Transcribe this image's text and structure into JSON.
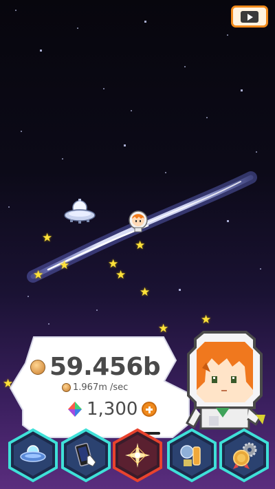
{
  "stats": {
    "coin_total": "59.456b",
    "coin_rate": "1.967m /sec",
    "gem_count": "1,300"
  },
  "icons": {
    "video": "video-ad-icon",
    "coin": "coin-icon",
    "gem": "rainbow-gem-icon",
    "add": "plus-icon"
  },
  "nav": [
    {
      "name": "ufo",
      "icon": "ufo-icon",
      "selected": false
    },
    {
      "name": "phone",
      "icon": "phone-tap-icon",
      "selected": false
    },
    {
      "name": "galaxy",
      "icon": "starburst-icon",
      "selected": true
    },
    {
      "name": "items",
      "icon": "items-icon",
      "selected": false
    },
    {
      "name": "achievements",
      "icon": "medal-gear-icon",
      "selected": false
    }
  ],
  "colors": {
    "accent": "#f08a1c",
    "nav_border": "#3fe0d8",
    "nav_selected_border": "#e8432e",
    "star": "#ffe23a"
  }
}
